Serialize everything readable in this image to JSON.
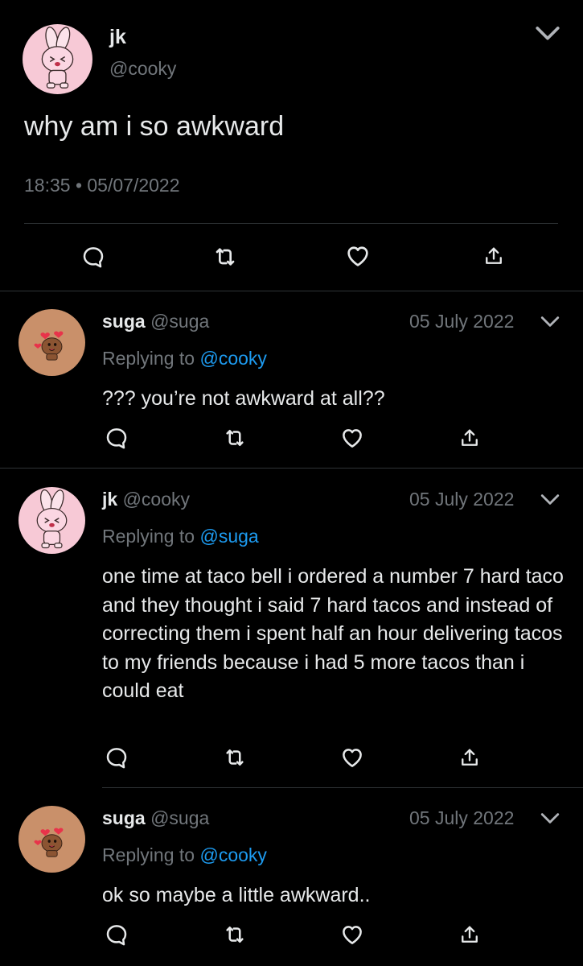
{
  "main_tweet": {
    "name": "jk",
    "handle": "@cooky",
    "text": "why am i so awkward",
    "time": "18:35 • 05/07/2022",
    "avatar": "cooky-bunny-avatar",
    "menu_icon": "chevron-down-icon",
    "actions": [
      "reply-icon",
      "retweet-icon",
      "like-icon",
      "share-icon"
    ]
  },
  "replies": [
    {
      "name": "suga",
      "handle": "@suga",
      "date": "05 July 2022",
      "replying_prefix": "Replying to",
      "replying_to": "@cooky",
      "text": "??? you’re not awkward at all??",
      "avatar": "shooky-cookie-avatar"
    },
    {
      "name": "jk",
      "handle": "@cooky",
      "date": "05 July 2022",
      "replying_prefix": "Replying to",
      "replying_to": "@suga",
      "text": "one time at taco bell i ordered a number 7 hard taco and they thought i said 7 hard tacos and instead of correcting them i spent half an hour delivering tacos to my friends because i had 5 more tacos than i could eat",
      "avatar": "cooky-bunny-avatar"
    },
    {
      "name": "suga",
      "handle": "@suga",
      "date": "05 July 2022",
      "replying_prefix": "Replying to",
      "replying_to": "@cooky",
      "text": "ok so maybe a little awkward..",
      "avatar": "shooky-cookie-avatar"
    }
  ],
  "colors": {
    "background": "#000000",
    "primary_text": "#e7e9ea",
    "secondary_text": "#71767b",
    "mention": "#1d9bf0",
    "divider": "#2f3336",
    "cooky_avatar_bg": "#f7c9d6",
    "shooky_avatar_bg": "#c9906a"
  }
}
